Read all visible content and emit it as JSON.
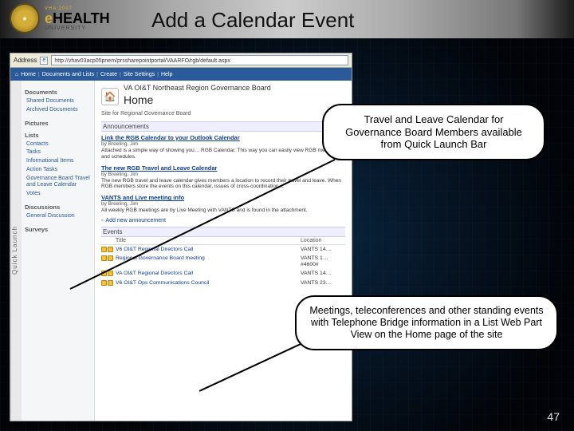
{
  "header": {
    "logo_top": "VHA 2007",
    "logo_mid_pre": "e",
    "logo_mid_main": "HEALTH",
    "logo_bot": "UNIVERSITY",
    "slide_title": "Add a Calendar Event"
  },
  "browser": {
    "address_label": "Address",
    "url": "http://vhav03acp05pnem/prssharepointportal/VAARFO/rgb/default.aspx"
  },
  "spnav": {
    "items": [
      "Home",
      "Documents and Lists",
      "Create",
      "Site Settings",
      "Help"
    ]
  },
  "ql_label": "Quick Launch",
  "sidebar": {
    "groups": [
      {
        "heading": "Documents",
        "items": [
          "Shared Documents",
          "Archived Documents"
        ]
      },
      {
        "heading": "Pictures",
        "items": []
      },
      {
        "heading": "Lists",
        "items": [
          "Contacts",
          "Tasks",
          "Informational Items",
          "Action Tasks",
          "Governance Board Travel and Leave Calendar",
          "Votes"
        ]
      },
      {
        "heading": "Discussions",
        "items": [
          "General Discussion"
        ]
      },
      {
        "heading": "Surveys",
        "items": []
      }
    ]
  },
  "main": {
    "site_title": "VA OI&T Northeast Region Governance Board",
    "page_h": "Home",
    "sub": "Site for Regional Governance Board",
    "ann_heading": "Announcements",
    "announcements": [
      {
        "title": "Link the RGB Calendar to your Outlook Calendar",
        "by": "by Breeling, Jim",
        "desc": "Attached is a simple way of showing you… RGB Calendar. This way you can easily view RGB meetings and schedules."
      },
      {
        "title": "The new RGB Travel and Leave Calendar",
        "by": "by Breeling, Jim",
        "desc": "The new RGB travel and leave calendar gives members a location to record their travel and leave. When RGB members store the events on this calendar, issues of cross-coordination…"
      },
      {
        "title": "VANTS and Live meeting info",
        "by": "by Breeling, Jim",
        "desc": "All weekly RGB meetings are by Live Meeting with VANTS and is found in the attachment."
      }
    ],
    "add_ann": "Add new announcement",
    "events_heading": "Events",
    "events_cols": {
      "c2": "Title",
      "c3": "Location"
    },
    "events": [
      {
        "title": "V6 OI&T Regional Directors Call",
        "loc": "VANTS 14…"
      },
      {
        "title": "Regional Governance Board meeting",
        "loc": "VANTS 1… #4600#"
      },
      {
        "title": "VA OI&T Regional Directors Call",
        "loc": "VANTS 14…"
      },
      {
        "title": "V6 OI&T Ops Communications Council",
        "loc": "VANTS 23…"
      }
    ]
  },
  "callouts": {
    "c1": "Travel and Leave Calendar for Governance Board Members available from Quick Launch Bar",
    "c2": "Meetings, teleconferences and other standing events with Telephone Bridge information in a List Web Part View on the Home page of the site"
  },
  "pagenum": "47"
}
